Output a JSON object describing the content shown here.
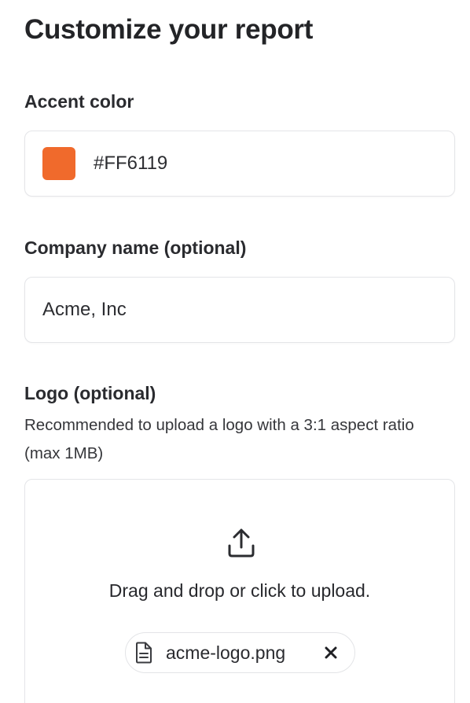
{
  "title": "Customize your report",
  "accent": {
    "label": "Accent color",
    "value": "#FF6119",
    "swatch_color": "#F06A2C"
  },
  "company": {
    "label": "Company name (optional)",
    "value": "Acme, Inc"
  },
  "logo": {
    "label": "Logo (optional)",
    "hint": "Recommended to upload a logo with a 3:1 aspect ratio (max 1MB)",
    "drop_text": "Drag and drop or click to upload.",
    "file_name": "acme-logo.png"
  }
}
